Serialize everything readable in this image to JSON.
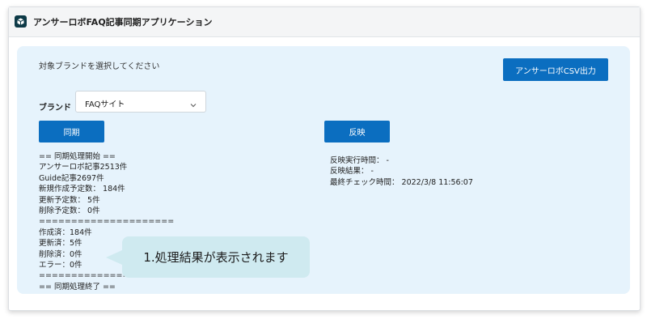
{
  "app": {
    "title": "アンサーロボFAQ記事同期アプリケーション",
    "icon": "cube-icon"
  },
  "panel": {
    "select_label": "対象ブランドを選択してください",
    "csv_button": "アンサーロボCSV出力",
    "brand_label": "ブランド",
    "brand_value": "FAQサイト",
    "sync_button": "同期",
    "apply_button": "反映"
  },
  "log_lines": [
    "== 同期処理開始 ==",
    "アンサーロボ記事2513件",
    "Guide記事2697件",
    "新規作成予定数： 184件",
    "更新予定数： 5件",
    "削除予定数： 0件",
    "=====================",
    "作成済：184件",
    "更新済：5件",
    "削除済：0件",
    "エラー：0件",
    "=====================",
    "== 同期処理終了 =="
  ],
  "result_lines": [
    "反映実行時間： -",
    "反映結果： -",
    "最終チェック時間： 2022/3/8 11:56:07"
  ],
  "callout": "1.処理結果が表示されます",
  "colors": {
    "accent": "#0b6ec0",
    "panel_bg": "#e6f3fc",
    "callout_bg": "#cfeaf0"
  }
}
